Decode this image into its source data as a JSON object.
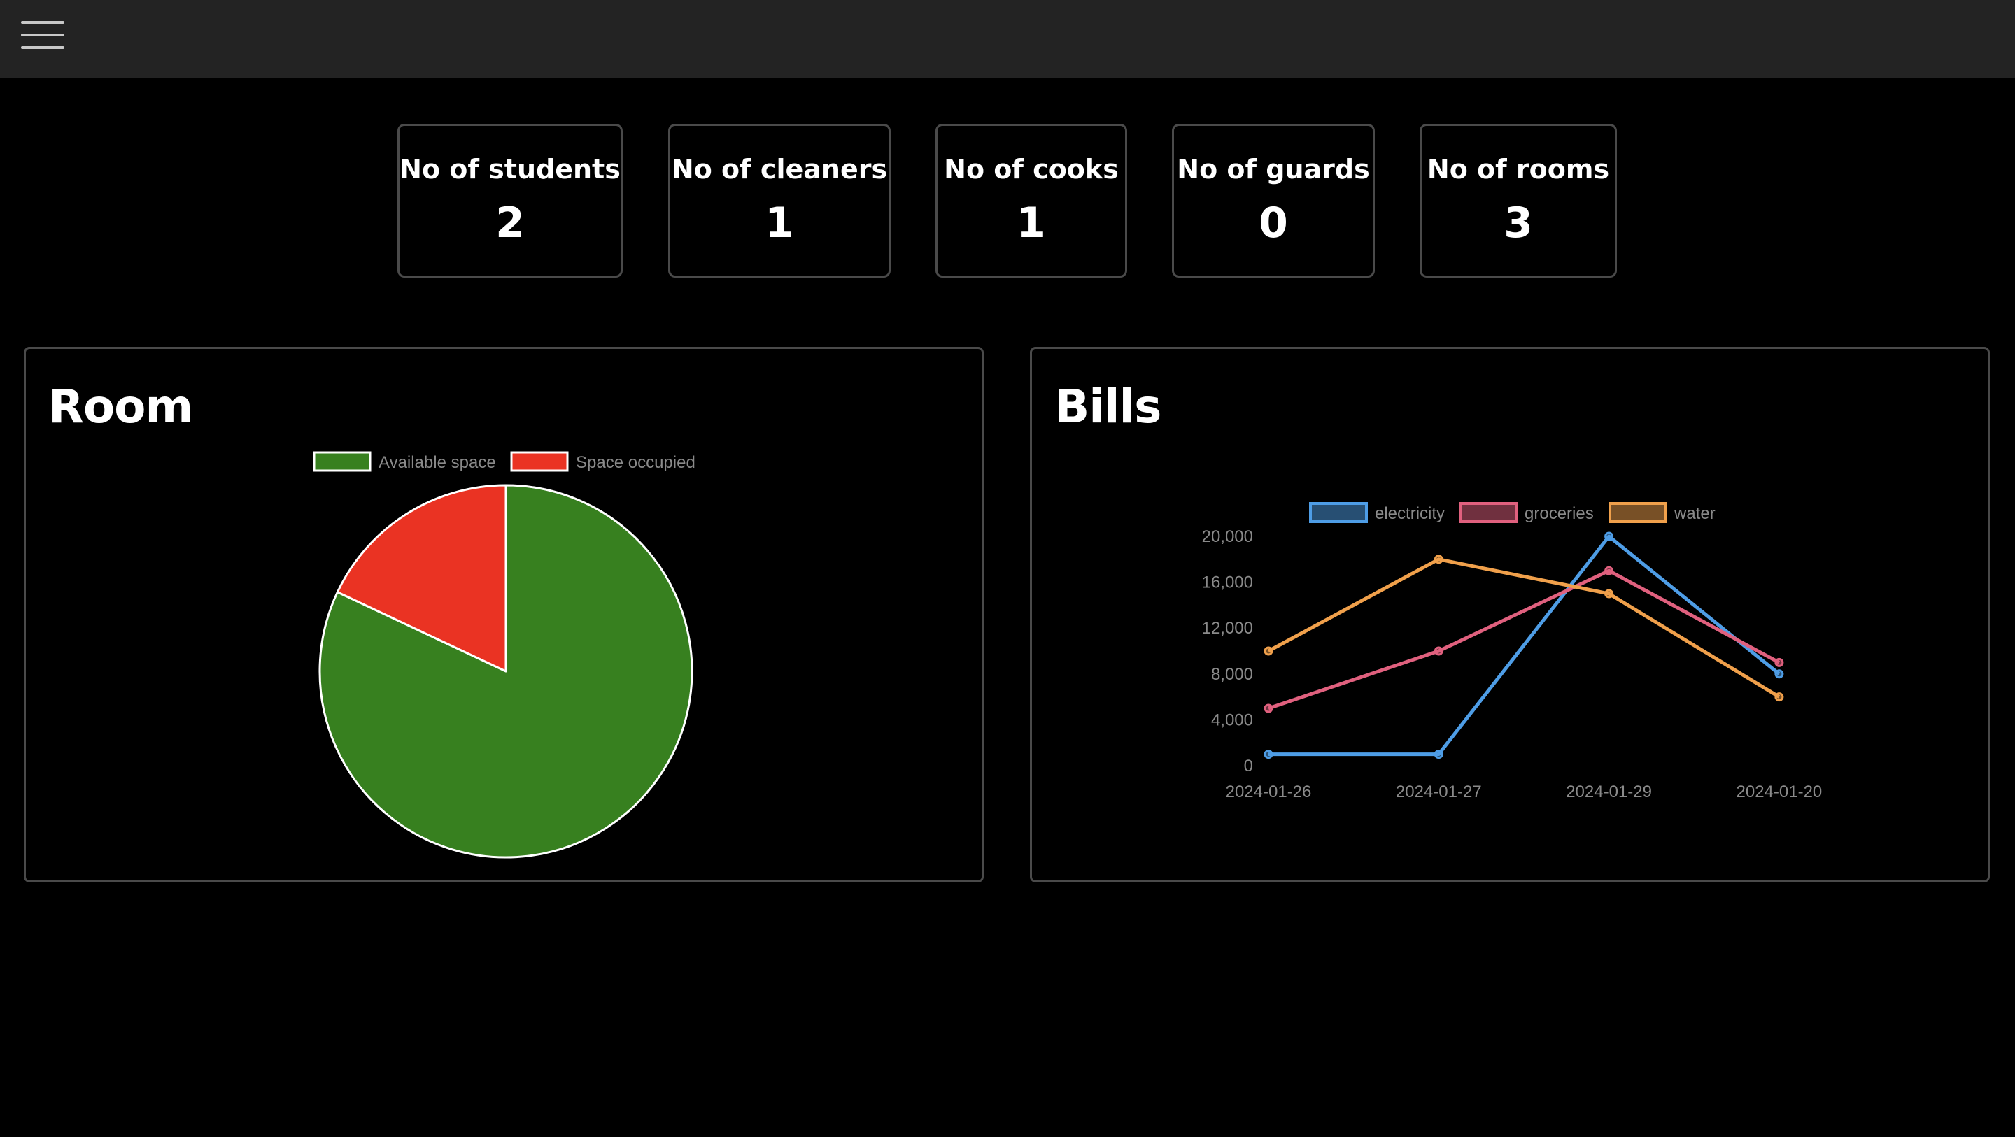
{
  "topbar": {
    "menu_icon": "hamburger-menu-icon"
  },
  "stats": [
    {
      "label": "No of students",
      "value": "2"
    },
    {
      "label": "No of cleaners",
      "value": "1"
    },
    {
      "label": "No of cooks",
      "value": "1"
    },
    {
      "label": "No of guards",
      "value": "0"
    },
    {
      "label": "No of rooms",
      "value": "3"
    }
  ],
  "room_panel": {
    "title": "Room"
  },
  "bills_panel": {
    "title": "Bills"
  },
  "colors": {
    "available": "#37801f",
    "occupied": "#ea3323",
    "electricity": "#4e9de6",
    "groceries": "#e0607e",
    "water": "#f0a04b",
    "text_muted": "#8a8a8a"
  },
  "chart_data": [
    {
      "type": "pie",
      "labels": [
        "Available space",
        "Space occupied"
      ],
      "values": [
        82,
        18
      ]
    },
    {
      "type": "line",
      "categories": [
        "2024-01-26",
        "2024-01-27",
        "2024-01-29",
        "2024-01-20"
      ],
      "series": [
        {
          "name": "electricity",
          "values": [
            1000,
            1000,
            20000,
            8000
          ]
        },
        {
          "name": "groceries",
          "values": [
            5000,
            10000,
            17000,
            9000
          ]
        },
        {
          "name": "water",
          "values": [
            10000,
            18000,
            15000,
            6000
          ]
        }
      ],
      "yticks": [
        "0",
        "4,000",
        "8,000",
        "12,000",
        "16,000",
        "20,000"
      ],
      "ylim": [
        0,
        20000
      ],
      "legend": "top"
    }
  ]
}
